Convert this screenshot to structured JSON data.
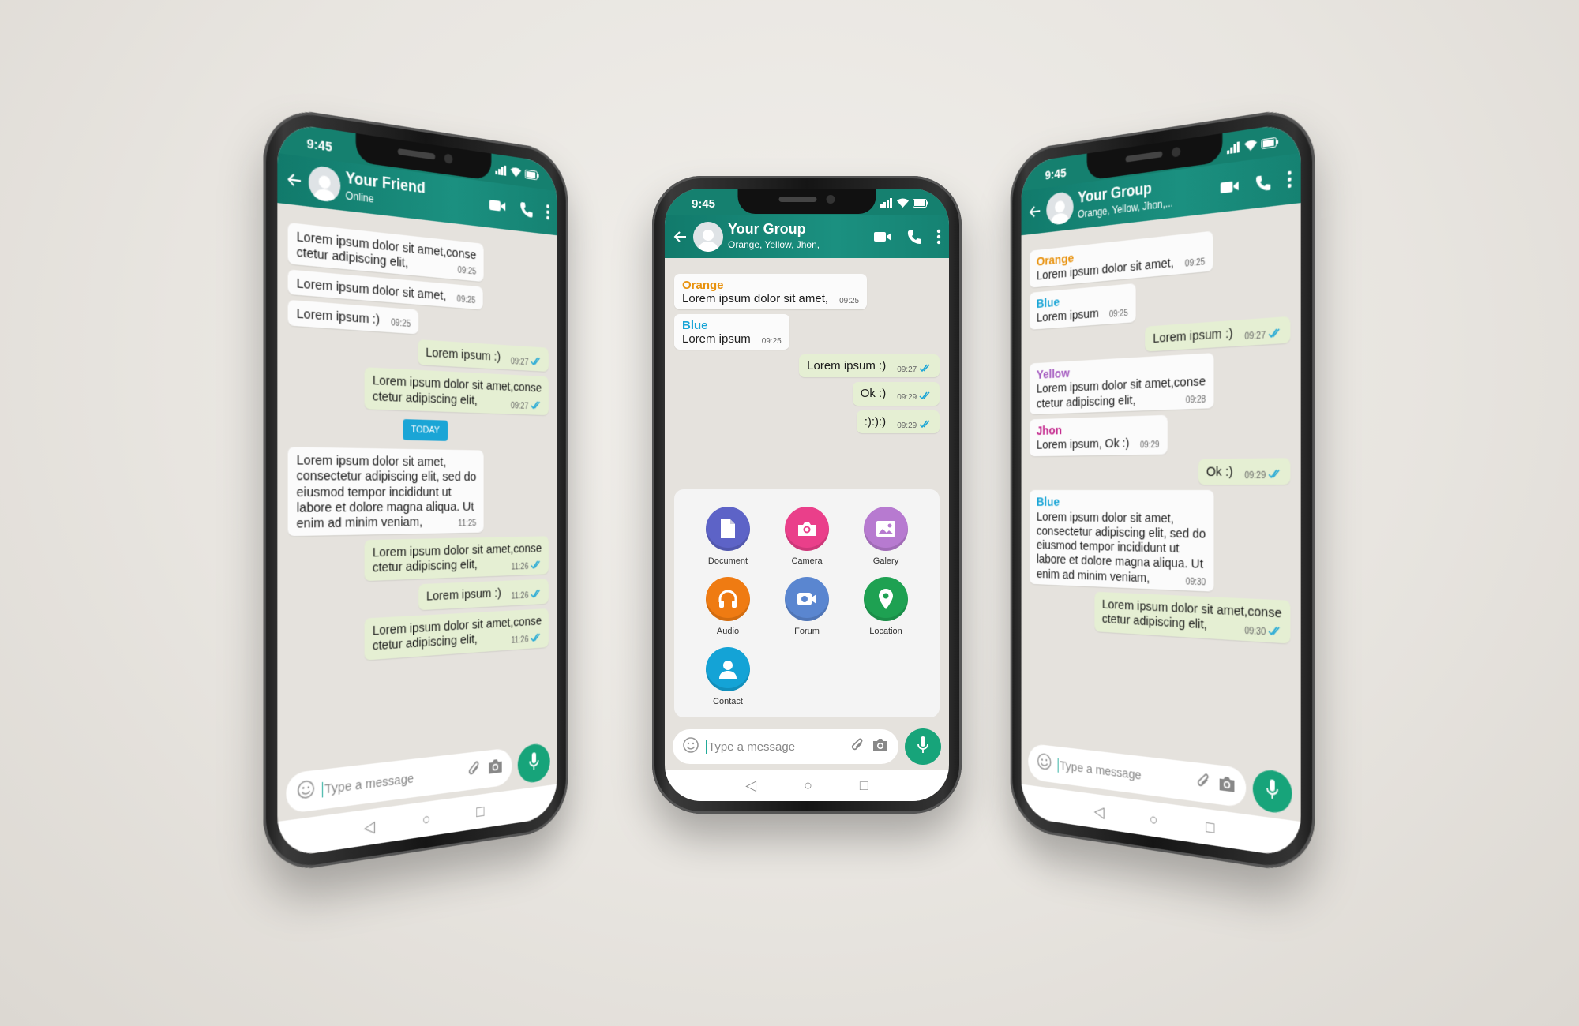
{
  "colors": {
    "header": "#15806f",
    "mic": "#17a47a",
    "out_bubble": "#e5efd3",
    "check": "#1aa5d6"
  },
  "phones": [
    {
      "status_time": "9:45",
      "title": "Your Friend",
      "subtitle": "Online",
      "input_placeholder": "Type a message",
      "messages": [
        {
          "side": "in",
          "text": "Lorem ipsum dolor sit amet,conse\nctetur adipiscing elit,",
          "time": "09:25"
        },
        {
          "side": "in",
          "text": "Lorem ipsum dolor sit amet,",
          "time": "09:25"
        },
        {
          "side": "in",
          "text": "Lorem ipsum :)",
          "time": "09:25"
        },
        {
          "side": "out",
          "text": "Lorem ipsum :)",
          "time": "09:27",
          "read": true
        },
        {
          "side": "out",
          "text": "Lorem ipsum dolor sit amet,conse\nctetur adipiscing elit,",
          "time": "09:27",
          "read": true
        },
        {
          "side": "date",
          "text": "TODAY"
        },
        {
          "side": "in",
          "text": "Lorem ipsum dolor sit amet,\nconsectetur adipiscing elit, sed do\neiusmod tempor incididunt ut\nlabore et dolore magna aliqua. Ut\nenim ad minim veniam,",
          "time": "11:25"
        },
        {
          "side": "out",
          "text": "Lorem ipsum dolor sit amet,conse\nctetur adipiscing elit,",
          "time": "11:26",
          "read": true
        },
        {
          "side": "out",
          "text": "Lorem ipsum :)",
          "time": "11:26",
          "read": true
        },
        {
          "side": "out",
          "text": "Lorem ipsum dolor sit amet,conse\nctetur adipiscing elit,",
          "time": "11:26",
          "read": true
        }
      ]
    },
    {
      "status_time": "9:45",
      "title": "Your Group",
      "subtitle": "Orange, Yellow, Jhon,",
      "input_placeholder": "Type a message",
      "messages": [
        {
          "side": "in",
          "sender": "Orange",
          "sender_color": "#e8920e",
          "text": "Lorem ipsum dolor sit amet,",
          "time": "09:25"
        },
        {
          "side": "in",
          "sender": "Blue",
          "sender_color": "#1aa5d6",
          "text": "Lorem ipsum",
          "time": "09:25"
        },
        {
          "side": "out",
          "text": "Lorem ipsum :)",
          "time": "09:27",
          "read": true
        },
        {
          "side": "out",
          "text": "Ok :)",
          "time": "09:29",
          "read": true
        },
        {
          "side": "out",
          "text": ":):):)",
          "time": "09:29",
          "read": true
        }
      ],
      "attachments": [
        {
          "label": "Document",
          "icon": "document-icon",
          "color": "#5d63c7"
        },
        {
          "label": "Camera",
          "icon": "camera-icon",
          "color": "#ea3f8a"
        },
        {
          "label": "Galery",
          "icon": "gallery-icon",
          "color": "#b77ad0"
        },
        {
          "label": "Audio",
          "icon": "headphones-icon",
          "color": "#ef7b12"
        },
        {
          "label": "Forum",
          "icon": "forum-icon",
          "color": "#5a86d0"
        },
        {
          "label": "Location",
          "icon": "location-icon",
          "color": "#1ea152"
        },
        {
          "label": "Contact",
          "icon": "contact-icon",
          "color": "#14a3d6"
        }
      ]
    },
    {
      "status_time": "9:45",
      "title": "Your Group",
      "subtitle": "Orange, Yellow, Jhon,...",
      "input_placeholder": "Type a message",
      "messages": [
        {
          "side": "in",
          "sender": "Orange",
          "sender_color": "#e8920e",
          "text": "Lorem ipsum dolor sit amet,",
          "time": "09:25"
        },
        {
          "side": "in",
          "sender": "Blue",
          "sender_color": "#1aa5d6",
          "text": "Lorem ipsum",
          "time": "09:25"
        },
        {
          "side": "out",
          "text": "Lorem ipsum :)",
          "time": "09:27",
          "read": true
        },
        {
          "side": "in",
          "sender": "Yellow",
          "sender_color": "#a55cc0",
          "text": "Lorem ipsum dolor sit amet,conse\nctetur adipiscing elit,",
          "time": "09:28"
        },
        {
          "side": "in",
          "sender": "Jhon",
          "sender_color": "#c42a8e",
          "text": "Lorem ipsum, Ok :)",
          "time": "09:29"
        },
        {
          "side": "out",
          "text": "Ok :)",
          "time": "09:29",
          "read": true
        },
        {
          "side": "in",
          "sender": "Blue",
          "sender_color": "#1aa5d6",
          "text": "Lorem ipsum dolor sit amet,\nconsectetur adipiscing elit, sed do\neiusmod tempor incididunt ut\nlabore et dolore magna aliqua. Ut\nenim ad minim veniam,",
          "time": "09:30"
        },
        {
          "side": "out",
          "text": "Lorem ipsum dolor sit amet,conse\nctetur adipiscing elit,",
          "time": "09:30",
          "read": true
        }
      ]
    }
  ]
}
